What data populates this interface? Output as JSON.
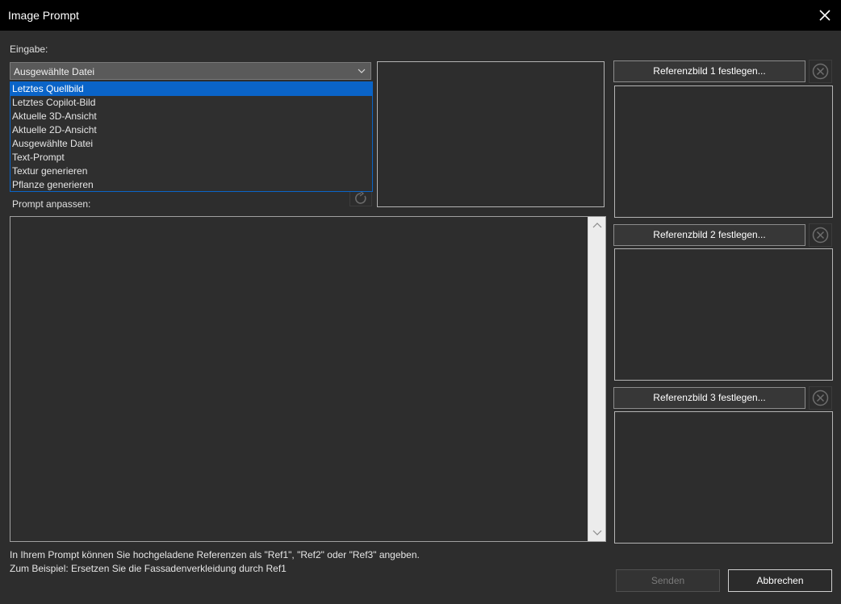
{
  "window": {
    "title": "Image Prompt"
  },
  "input": {
    "label": "Eingabe:",
    "selected": "Ausgewählte Datei",
    "options": [
      "Letztes Quellbild",
      "Letztes Copilot-Bild",
      "Aktuelle 3D-Ansicht",
      "Aktuelle 2D-Ansicht",
      "Ausgewählte Datei",
      "Text-Prompt",
      "Textur generieren",
      "Pflanze generieren"
    ],
    "highlighted_option": "Letztes Quellbild"
  },
  "prompt": {
    "label": "Prompt anpassen:",
    "value": ""
  },
  "references": [
    {
      "button_label": "Referenzbild 1 festlegen..."
    },
    {
      "button_label": "Referenzbild 2 festlegen..."
    },
    {
      "button_label": "Referenzbild 3 festlegen..."
    }
  ],
  "hint": {
    "line1": "In Ihrem Prompt können Sie hochgeladene Referenzen als \"Ref1\", \"Ref2\" oder \"Ref3\" angeben.",
    "line2": "Zum Beispiel: Ersetzen Sie die Fassadenverkleidung durch Ref1"
  },
  "actions": {
    "send_label": "Senden",
    "cancel_label": "Abbrechen"
  },
  "colors": {
    "accent": "#0a64c8",
    "titlebar": "#000000",
    "background": "#2d2d2d"
  },
  "icons": [
    "close-icon",
    "chevron-down-icon",
    "refresh-icon",
    "circle-x-icon",
    "scroll-up-icon",
    "scroll-down-icon"
  ]
}
